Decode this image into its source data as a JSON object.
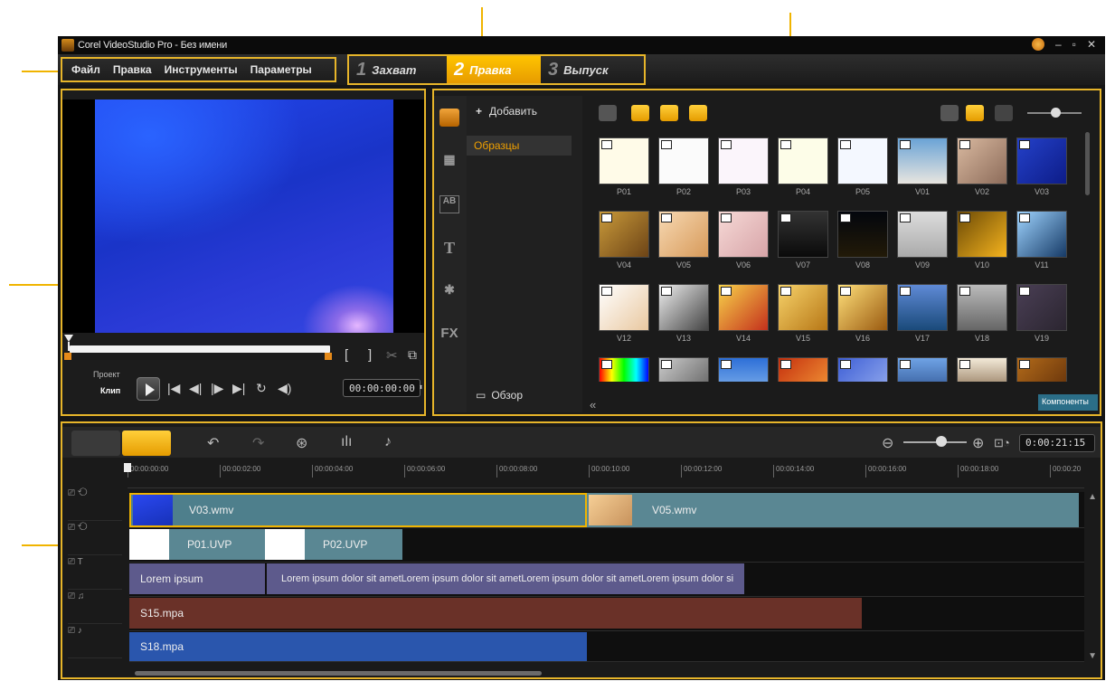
{
  "window": {
    "title": "Corel VideoStudio Pro - Без имени"
  },
  "menu": {
    "items": [
      "Файл",
      "Правка",
      "Инструменты",
      "Параметры"
    ]
  },
  "steps": [
    {
      "num": "1",
      "label": "Захват"
    },
    {
      "num": "2",
      "label": "Правка",
      "active": true
    },
    {
      "num": "3",
      "label": "Выпуск"
    }
  ],
  "player": {
    "project_label": "Проект",
    "clip_label": "Клип",
    "timecode": "00:00:00:00"
  },
  "library": {
    "add_label": "Добавить",
    "folder": "Образцы",
    "browse_label": "Обзор",
    "components_label": "Компоненты",
    "thumbnails": [
      "P01",
      "P02",
      "P03",
      "P04",
      "P05",
      "V01",
      "V02",
      "V03",
      "V04",
      "V05",
      "V06",
      "V07",
      "V08",
      "V09",
      "V10",
      "V11",
      "V12",
      "V13",
      "V14",
      "V15",
      "V16",
      "V17",
      "V18",
      "V19",
      "",
      "",
      "",
      "",
      "",
      "",
      "",
      ""
    ]
  },
  "timeline": {
    "duration": "0:00:21:15",
    "ruler_ticks": [
      "00:00:00:00",
      "00:00:02:00",
      "00:00:04:00",
      "00:00:06:00",
      "00:00:08:00",
      "00:00:10:00",
      "00:00:12:00",
      "00:00:14:00",
      "00:00:16:00",
      "00:00:18:00",
      "00:00:20"
    ],
    "clips": {
      "video1": "V03.wmv",
      "video2": "V05.wmv",
      "overlay1": "P01.UVP",
      "overlay2": "P02.UVP",
      "title1": "Lorem ipsum",
      "title2": "Lorem ipsum dolor sit ametLorem ipsum dolor sit ametLorem ipsum dolor sit ametLorem ipsum dolor si",
      "voice": "S15.mpa",
      "music": "S18.mpa"
    }
  },
  "colors": {
    "accent": "#e7b52a",
    "video_clip": "#5a8793",
    "title_clip": "#5d5a8c",
    "voice_clip": "#6a3128",
    "music_clip": "#2a56ad"
  }
}
